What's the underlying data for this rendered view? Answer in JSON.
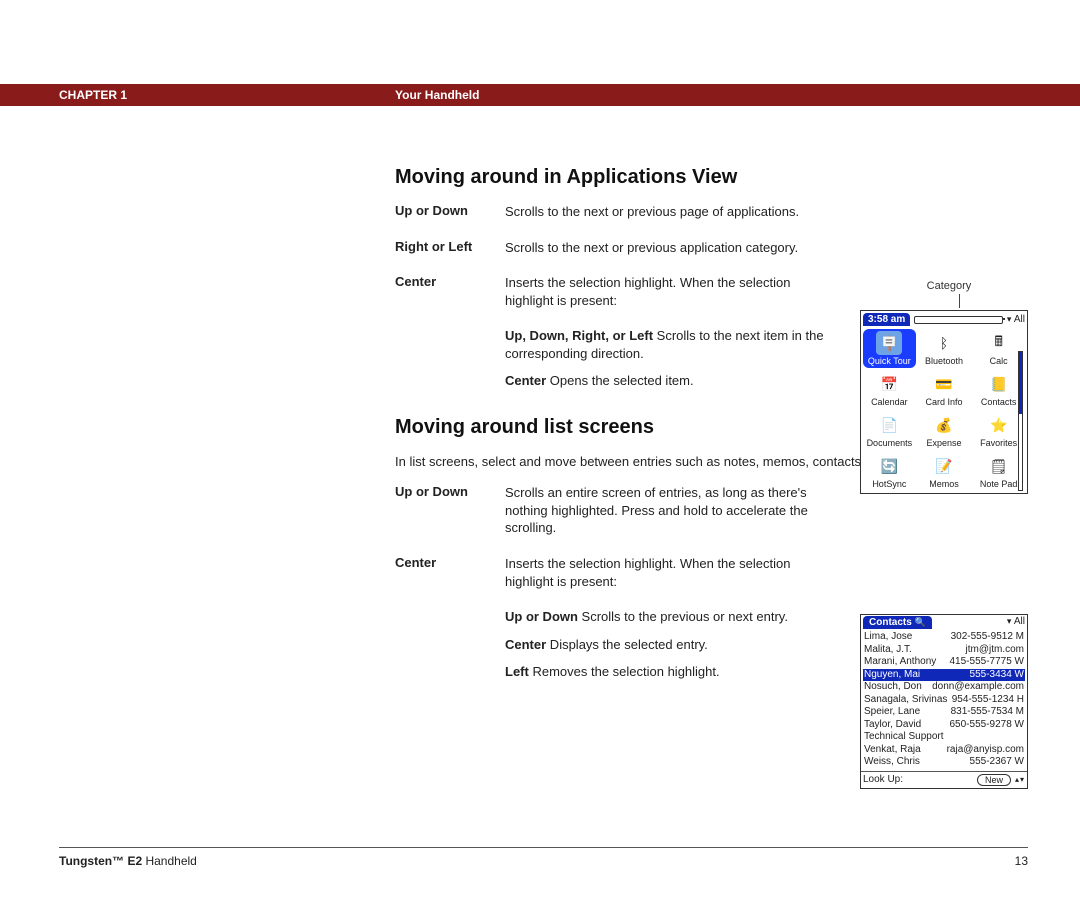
{
  "header": {
    "chapter": "CHAPTER 1",
    "section": "Your Handheld"
  },
  "footer": {
    "product_bold": "Tungsten™ E2",
    "product_rest": " Handheld",
    "page": "13"
  },
  "h_apps": "Moving around in Applications View",
  "apps_rows": {
    "r1_label": "Up or Down",
    "r1_desc": "Scrolls to the next or previous page of applications.",
    "r2_label": "Right or Left",
    "r2_desc": "Scrolls to the next or previous application category.",
    "r3_label": "Center",
    "r3_desc": "Inserts the selection highlight. When the selection highlight is present:",
    "sub1_b": "Up, Down, Right, or Left",
    "sub1_rest": " Scrolls to the next item in the corresponding direction.",
    "sub2_b": "Center",
    "sub2_rest": " Opens the selected item."
  },
  "h_list": "Moving around list screens",
  "list_intro": "In list screens, select and move between entries such as notes, memos, contacts, or photos.",
  "list_rows": {
    "r1_label": "Up or Down",
    "r1_desc": "Scrolls an entire screen of entries, as long as there's nothing highlighted. Press and hold to accelerate the scrolling.",
    "r2_label": "Center",
    "r2_desc": "Inserts the selection highlight. When the selection highlight is present:",
    "sub1_b": "Up or Down",
    "sub1_rest": " Scrolls to the previous or next entry.",
    "sub2_b": "Center",
    "sub2_rest": " Displays the selected entry.",
    "sub3_b": "Left",
    "sub3_rest": " Removes the selection highlight."
  },
  "apps_fig": {
    "caption": "Category",
    "time": "3:58 am",
    "all": "All",
    "apps": [
      {
        "label": "Quick Tour",
        "icon": "🪧",
        "bg": "#6ea3e6",
        "sel": true
      },
      {
        "label": "Bluetooth",
        "icon": "ᛒ",
        "bg": "#dbe6ff"
      },
      {
        "label": "Calc",
        "icon": "🖩",
        "bg": "#dbe6ff"
      },
      {
        "label": "Calendar",
        "icon": "📅",
        "bg": "#dbe6ff"
      },
      {
        "label": "Card Info",
        "icon": "💳",
        "bg": "#dbe6ff"
      },
      {
        "label": "Contacts",
        "icon": "📒",
        "bg": "#e8cc66"
      },
      {
        "label": "Documents",
        "icon": "📄",
        "bg": "#dbe6ff"
      },
      {
        "label": "Expense",
        "icon": "💰",
        "bg": "#e8cc66"
      },
      {
        "label": "Favorites",
        "icon": "⭐",
        "bg": "#e8cc66"
      },
      {
        "label": "HotSync",
        "icon": "🔄",
        "bg": "#c83a3a"
      },
      {
        "label": "Memos",
        "icon": "📝",
        "bg": "#e8e8e8"
      },
      {
        "label": "Note Pad",
        "icon": "🗒",
        "bg": "#e8e8e8"
      }
    ]
  },
  "contacts_fig": {
    "title": "Contacts",
    "all": "All",
    "contacts": [
      {
        "name": "Lima, Jose",
        "value": "302-555-9512 M"
      },
      {
        "name": "Malita, J.T.",
        "value": "jtm@jtm.com"
      },
      {
        "name": "Marani, Anthony",
        "value": "415-555-7775 W"
      },
      {
        "name": "Nguyen, Mai",
        "value": "555-3434 W",
        "sel": true
      },
      {
        "name": "Nosuch, Don",
        "value": "donn@example.com"
      },
      {
        "name": "Sanagala, Srivinas",
        "value": "954-555-1234 H"
      },
      {
        "name": "Speier, Lane",
        "value": "831-555-7534 M"
      },
      {
        "name": "Taylor, David",
        "value": "650-555-9278 W"
      },
      {
        "name": "Technical Support",
        "value": ""
      },
      {
        "name": "Venkat, Raja",
        "value": "raja@anyisp.com"
      },
      {
        "name": "Weiss, Chris",
        "value": "555-2367 W"
      }
    ],
    "lookup": "Look Up:",
    "new": "New"
  }
}
